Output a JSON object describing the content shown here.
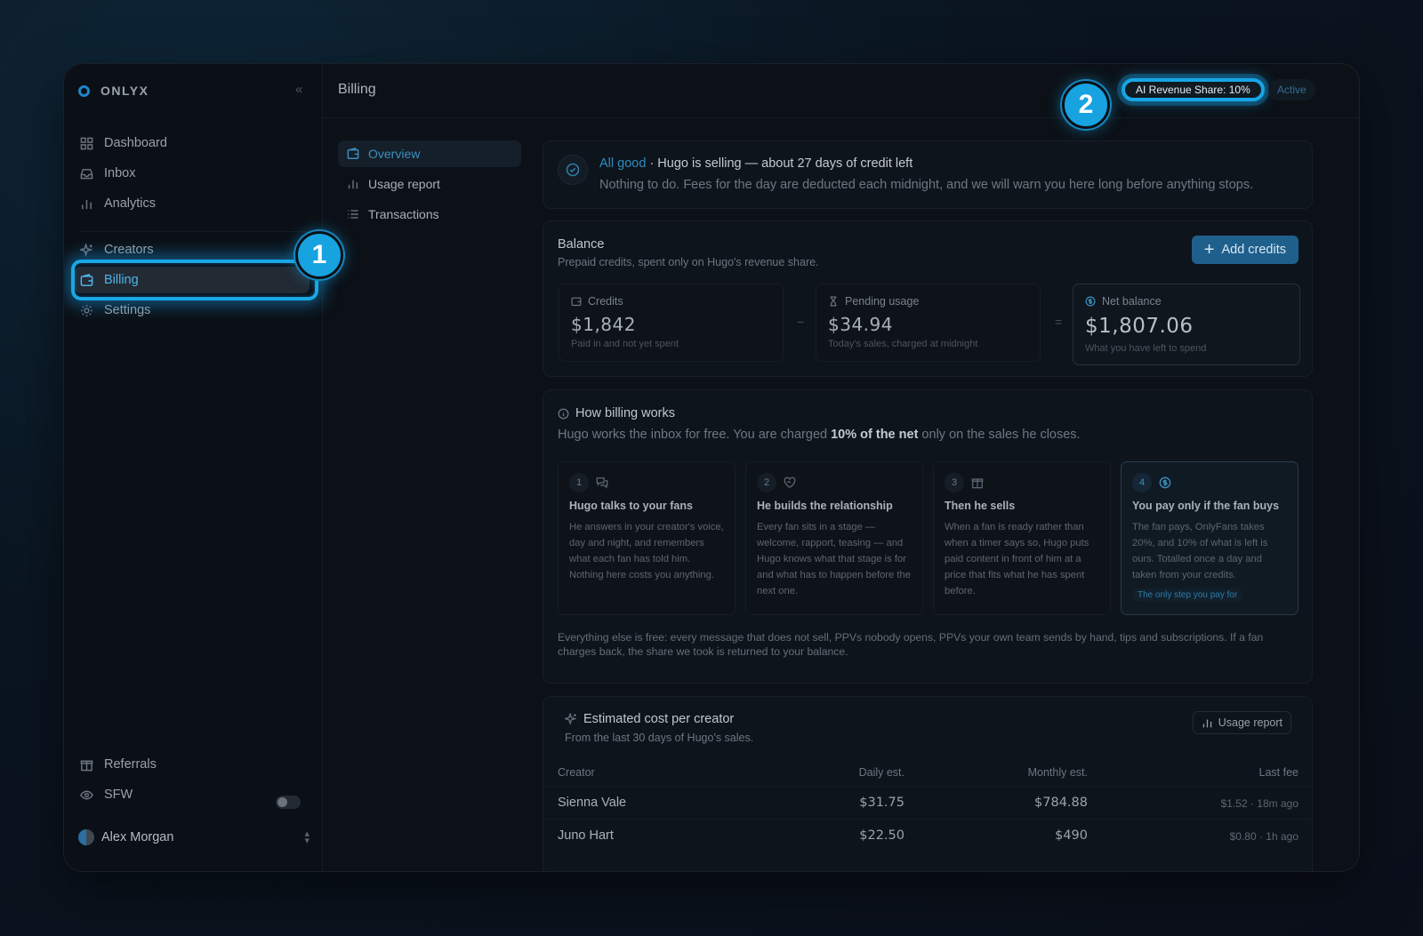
{
  "app": {
    "logo_text": "ONLYX",
    "collapse_icon": "«"
  },
  "sidebar": {
    "items": [
      {
        "label": "Dashboard",
        "icon": "grid-icon"
      },
      {
        "label": "Inbox",
        "icon": "inbox-icon"
      },
      {
        "label": "Analytics",
        "icon": "bar-chart-icon"
      },
      {
        "label": "Creators",
        "icon": "sparkle-icon"
      },
      {
        "label": "Billing",
        "icon": "wallet-icon",
        "active": true
      },
      {
        "label": "Settings",
        "icon": "gear-icon"
      }
    ],
    "bottom": [
      {
        "label": "Referrals",
        "icon": "gift-icon"
      },
      {
        "label": "SFW",
        "icon": "eye-icon"
      }
    ],
    "user": {
      "name": "Alex Morgan"
    }
  },
  "header": {
    "title": "Billing",
    "revenue_share": "AI Revenue Share: 10%",
    "status": "Active"
  },
  "callouts": [
    "1",
    "2"
  ],
  "subnav": [
    "Overview",
    "Usage report",
    "Transactions"
  ],
  "status_card": {
    "state": "All good",
    "headline": "· Hugo is selling — about 27 days of credit left",
    "detail": "Nothing to do. Fees for the day are deducted each midnight, and we will warn you here long before anything stops."
  },
  "balance": {
    "title": "Balance",
    "subtitle": "Prepaid credits, spent only on Hugo's revenue share.",
    "add_label": "Add credits",
    "minus": "−",
    "equals": "=",
    "metrics": [
      {
        "label": "Credits",
        "value": "$1,842",
        "hint": "Paid in and not yet spent"
      },
      {
        "label": "Pending usage",
        "value": "$34.94",
        "hint": "Today's sales, charged at midnight"
      },
      {
        "label": "Net balance",
        "value": "$1,807.06",
        "hint": "What you have left to spend"
      }
    ]
  },
  "how": {
    "title": "How billing works",
    "intro_pre": "Hugo works the inbox for free. You are charged ",
    "intro_bold": "10% of the net",
    "intro_post": " only on the sales he closes.",
    "steps": [
      {
        "n": "1",
        "title": "Hugo talks to your fans",
        "desc": "He answers in your creator's voice, day and night, and remembers what each fan has told him. Nothing here costs you anything."
      },
      {
        "n": "2",
        "title": "He builds the relationship",
        "desc": "Every fan sits in a stage — welcome, rapport, teasing — and Hugo knows what that stage is for and what has to happen before the next one."
      },
      {
        "n": "3",
        "title": "Then he sells",
        "desc": "When a fan is ready rather than when a timer says so, Hugo puts paid content in front of him at a price that fits what he has spent before."
      },
      {
        "n": "4",
        "title": "You pay only if the fan buys",
        "desc": "The fan pays, OnlyFans takes 20%, and 10% of what is left is ours. Totalled once a day and taken from your credits.",
        "tag": "The only step you pay for"
      }
    ],
    "footnote": "Everything else is free: every message that does not sell, PPVs nobody opens, PPVs your own team sends by hand, tips and subscriptions. If a fan charges back, the share we took is returned to your balance."
  },
  "estimate": {
    "title": "Estimated cost per creator",
    "subtitle": "From the last 30 days of Hugo's sales.",
    "button": "Usage report",
    "columns": [
      "Creator",
      "Daily est.",
      "Monthly est.",
      "Last fee"
    ],
    "rows": [
      [
        "Sienna Vale",
        "$31.75",
        "$784.88",
        "$1.52 · 18m ago"
      ],
      [
        "Juno Hart",
        "$22.50",
        "$490",
        "$0.80 · 1h ago"
      ]
    ]
  }
}
